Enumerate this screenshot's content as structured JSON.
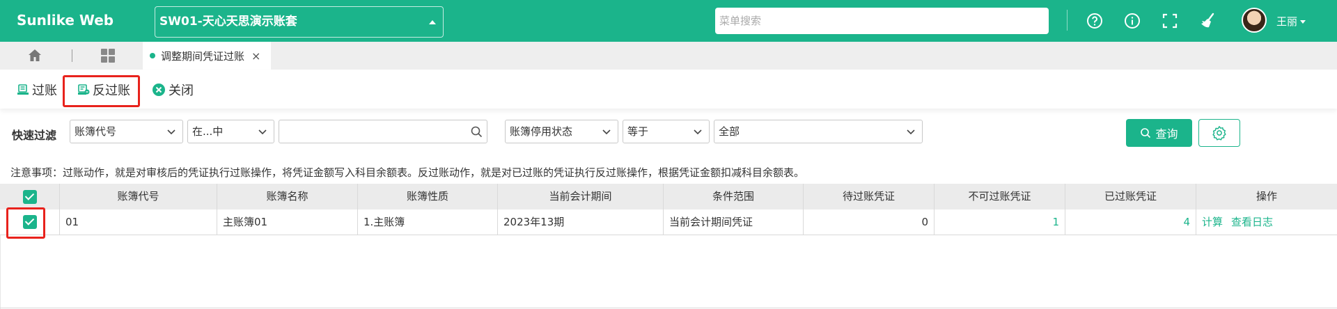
{
  "header": {
    "logo": "Sunlike Web",
    "account": "SW01-天心天思演示账套",
    "search_placeholder": "菜单搜索",
    "user_name": "王丽",
    "icons": [
      "help-icon",
      "info-icon",
      "fullscreen-icon",
      "broom-icon"
    ]
  },
  "tabs": {
    "active_label": "调整期间凭证过账",
    "close_glyph": "×"
  },
  "toolbar": {
    "post_label": "过账",
    "unpost_label": "反过账",
    "close_label": "关闭"
  },
  "filter": {
    "label": "快速过滤",
    "field1": "账簿代号",
    "op1": "在...中",
    "value1": "",
    "field2": "账簿停用状态",
    "op2": "等于",
    "value2": "全部",
    "query_label": "查询"
  },
  "notice": "注意事项：过账动作，就是对审核后的凭证执行过账操作，将凭证金额写入科目余额表。反过账动作，就是对已过账的凭证执行反过账操作，根据凭证金额扣减科目余额表。",
  "table": {
    "columns": [
      "账簿代号",
      "账簿名称",
      "账簿性质",
      "当前会计期间",
      "条件范围",
      "待过账凭证",
      "不可过账凭证",
      "已过账凭证",
      "操作"
    ],
    "rows": [
      {
        "code": "01",
        "name": "主账簿01",
        "nature": "1.主账簿",
        "period": "2023年13期",
        "range": "当前会计期间凭证",
        "pending": "0",
        "unpostable": "1",
        "posted": "4",
        "op_calc": "计算",
        "op_log": "查看日志"
      }
    ]
  },
  "colors": {
    "brand": "#1bb48b",
    "highlight": "#e8221c"
  }
}
